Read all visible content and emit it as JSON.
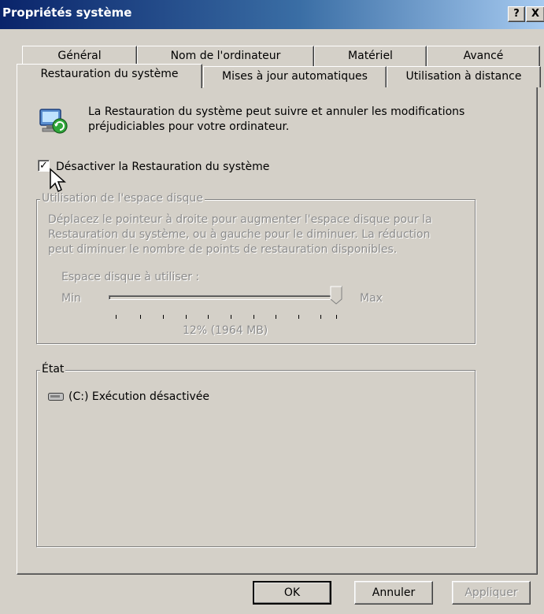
{
  "window": {
    "title": "Propriétés système",
    "help_button": "?",
    "close_button": "X"
  },
  "tabs_back": [
    {
      "label": "Général"
    },
    {
      "label": "Nom de l'ordinateur"
    },
    {
      "label": "Matériel"
    },
    {
      "label": "Avancé"
    }
  ],
  "tabs_front": [
    {
      "label": "Restauration du système",
      "active": true
    },
    {
      "label": "Mises à jour automatiques"
    },
    {
      "label": "Utilisation à distance"
    }
  ],
  "intro": {
    "line1": "La Restauration du système peut suivre et annuler les modifications",
    "line2": "préjudiciables pour votre ordinateur.",
    "icon": "system-restore-icon"
  },
  "disable_checkbox": {
    "label": "Désactiver la Restauration du système",
    "checked": true
  },
  "disk_usage": {
    "title": "Utilisation de l'espace disque",
    "desc1": "Déplacez le pointeur à droite pour augmenter l'espace disque pour la",
    "desc2": "Restauration du système, ou à gauche pour le diminuer. La réduction",
    "desc3": "peut diminuer le nombre de points de restauration disponibles.",
    "space_label": "Espace disque à utiliser :",
    "min_label": "Min",
    "max_label": "Max",
    "value_text": "12% (1964 MB)",
    "slider_level": 1.0
  },
  "status": {
    "title": "État",
    "drive_icon": "drive-icon",
    "drive_text": "(C:) Exécution désactivée"
  },
  "buttons": {
    "ok": "OK",
    "cancel": "Annuler",
    "apply": "Appliquer"
  }
}
